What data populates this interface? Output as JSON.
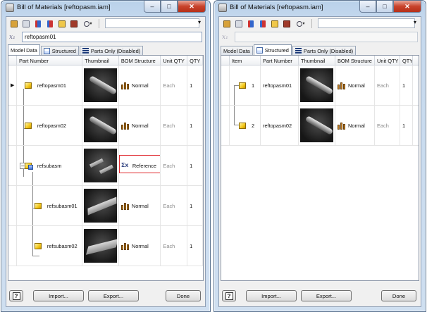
{
  "left_window": {
    "title": "Bill of Materials [reftopasm.iam]",
    "search_value": "reftopasm01",
    "tabs": [
      {
        "label": "Model Data",
        "active": true,
        "icon": "none"
      },
      {
        "label": "Structured",
        "active": false,
        "icon": "structured-icon"
      },
      {
        "label": "Parts Only (Disabled)",
        "active": false,
        "icon": "parts-only-icon"
      }
    ],
    "columns": [
      "Part Number",
      "Thumbnail",
      "BOM Structure",
      "Unit QTY",
      "QTY"
    ],
    "rows": [
      {
        "part_number": "reftopasm01",
        "bom_structure": "Normal",
        "unit_qty": "Each",
        "qty": "1",
        "thumbnail": "cylinder-rod",
        "icon": "part-icon"
      },
      {
        "part_number": "reftopasm02",
        "bom_structure": "Normal",
        "unit_qty": "Each",
        "qty": "1",
        "thumbnail": "cylinder-rod",
        "icon": "part-icon"
      },
      {
        "part_number": "refsubasm",
        "bom_structure": "Reference",
        "unit_qty": "Each",
        "qty": "1",
        "thumbnail": "two-plates",
        "icon": "assembly-icon"
      },
      {
        "part_number": "refsubasm01",
        "bom_structure": "Normal",
        "unit_qty": "Each",
        "qty": "1",
        "thumbnail": "flat-bar",
        "icon": "part-icon"
      },
      {
        "part_number": "refsubasm02",
        "bom_structure": "Normal",
        "unit_qty": "Each",
        "qty": "1",
        "thumbnail": "flat-bar",
        "icon": "part-icon"
      }
    ],
    "buttons": {
      "import": "Import...",
      "export": "Export...",
      "done": "Done"
    }
  },
  "right_window": {
    "title": "Bill of Materials [reftopasm.iam]",
    "search_value": "",
    "tabs": [
      {
        "label": "Model Data",
        "active": false,
        "icon": "none"
      },
      {
        "label": "Structured",
        "active": true,
        "icon": "structured-icon"
      },
      {
        "label": "Parts Only (Disabled)",
        "active": false,
        "icon": "parts-only-icon"
      }
    ],
    "columns": [
      "Item",
      "Part Number",
      "Thumbnail",
      "BOM Structure",
      "Unit QTY",
      "QTY"
    ],
    "rows": [
      {
        "item": "1",
        "part_number": "reftopasm01",
        "bom_structure": "Normal",
        "unit_qty": "Each",
        "qty": "1",
        "thumbnail": "cylinder-rod",
        "icon": "part-icon"
      },
      {
        "item": "2",
        "part_number": "reftopasm02",
        "bom_structure": "Normal",
        "unit_qty": "Each",
        "qty": "1",
        "thumbnail": "cylinder-rod",
        "icon": "part-icon"
      }
    ],
    "buttons": {
      "import": "Import...",
      "export": "Export...",
      "done": "Done"
    }
  },
  "colors": {
    "highlight_border": "#e0262c",
    "title_bar": "#c6d9ee",
    "close_button": "#c8432b"
  }
}
